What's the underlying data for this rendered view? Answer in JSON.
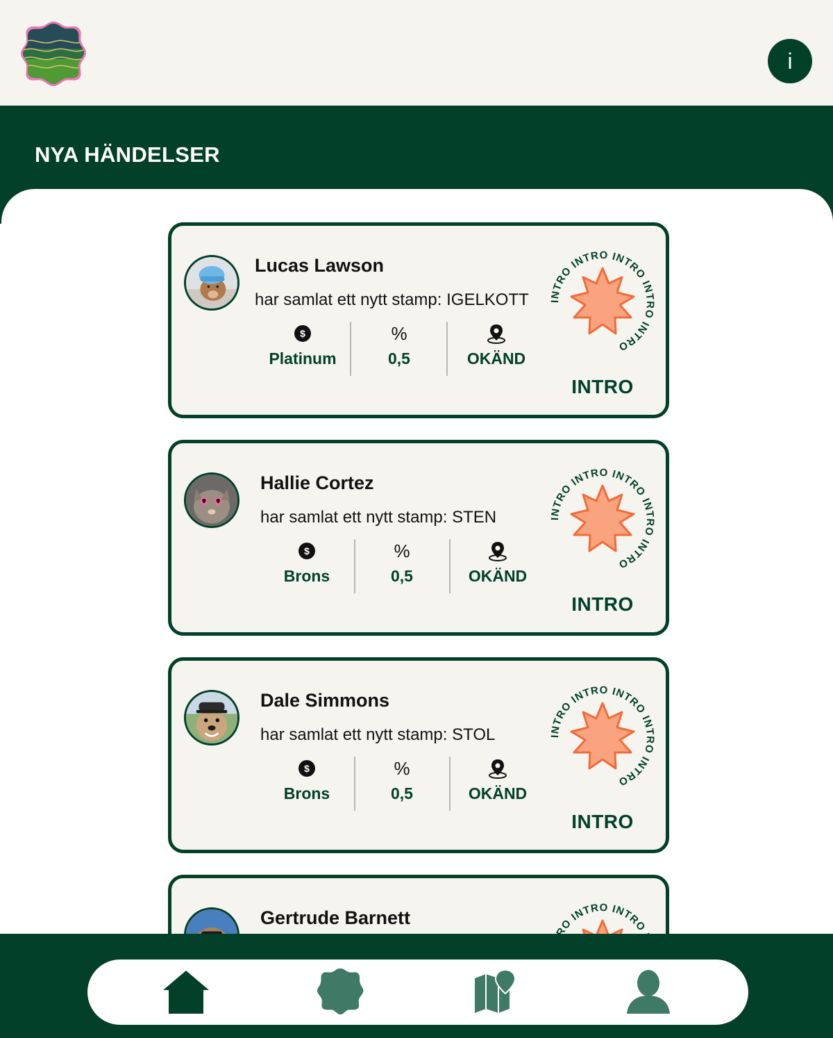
{
  "header": {
    "logo_icon": "wavy-badge-logo-icon",
    "info_label": "i"
  },
  "page": {
    "title": "NYA HÄNDELSER"
  },
  "events": [
    {
      "name": "Lucas Lawson",
      "text": "har samlat ett nytt stamp: IGELKOTT",
      "tier": "Platinum",
      "percent_symbol": "%",
      "percent": "0,5",
      "location": "OKÄND",
      "badge_label": "INTRO",
      "avatar": "dog-in-blue-hat"
    },
    {
      "name": "Hallie Cortez",
      "text": "har samlat ett nytt stamp: STEN",
      "tier": "Brons",
      "percent_symbol": "%",
      "percent": "0,5",
      "location": "OKÄND",
      "badge_label": "INTRO",
      "avatar": "cat-with-heart-sunglasses"
    },
    {
      "name": "Dale Simmons",
      "text": "har samlat ett nytt stamp: STOL",
      "tier": "Brons",
      "percent_symbol": "%",
      "percent": "0,5",
      "location": "OKÄND",
      "badge_label": "INTRO",
      "avatar": "dog-with-cap"
    },
    {
      "name": "Gertrude Barnett",
      "avatar": "capybara-with-sunglasses"
    }
  ],
  "badge_ring_text": "INTRO INTRO INTRO INTRO INTRO ",
  "nav": {
    "items": [
      "home-icon",
      "badge-icon",
      "map-icon",
      "profile-icon"
    ]
  },
  "colors": {
    "primary": "#02402a",
    "card_bg": "#f5f4ef",
    "badge_fill": "#f9a47f",
    "badge_stroke": "#f26b3a",
    "nav_active": "#02402a",
    "nav_inactive": "#3f7a66"
  }
}
